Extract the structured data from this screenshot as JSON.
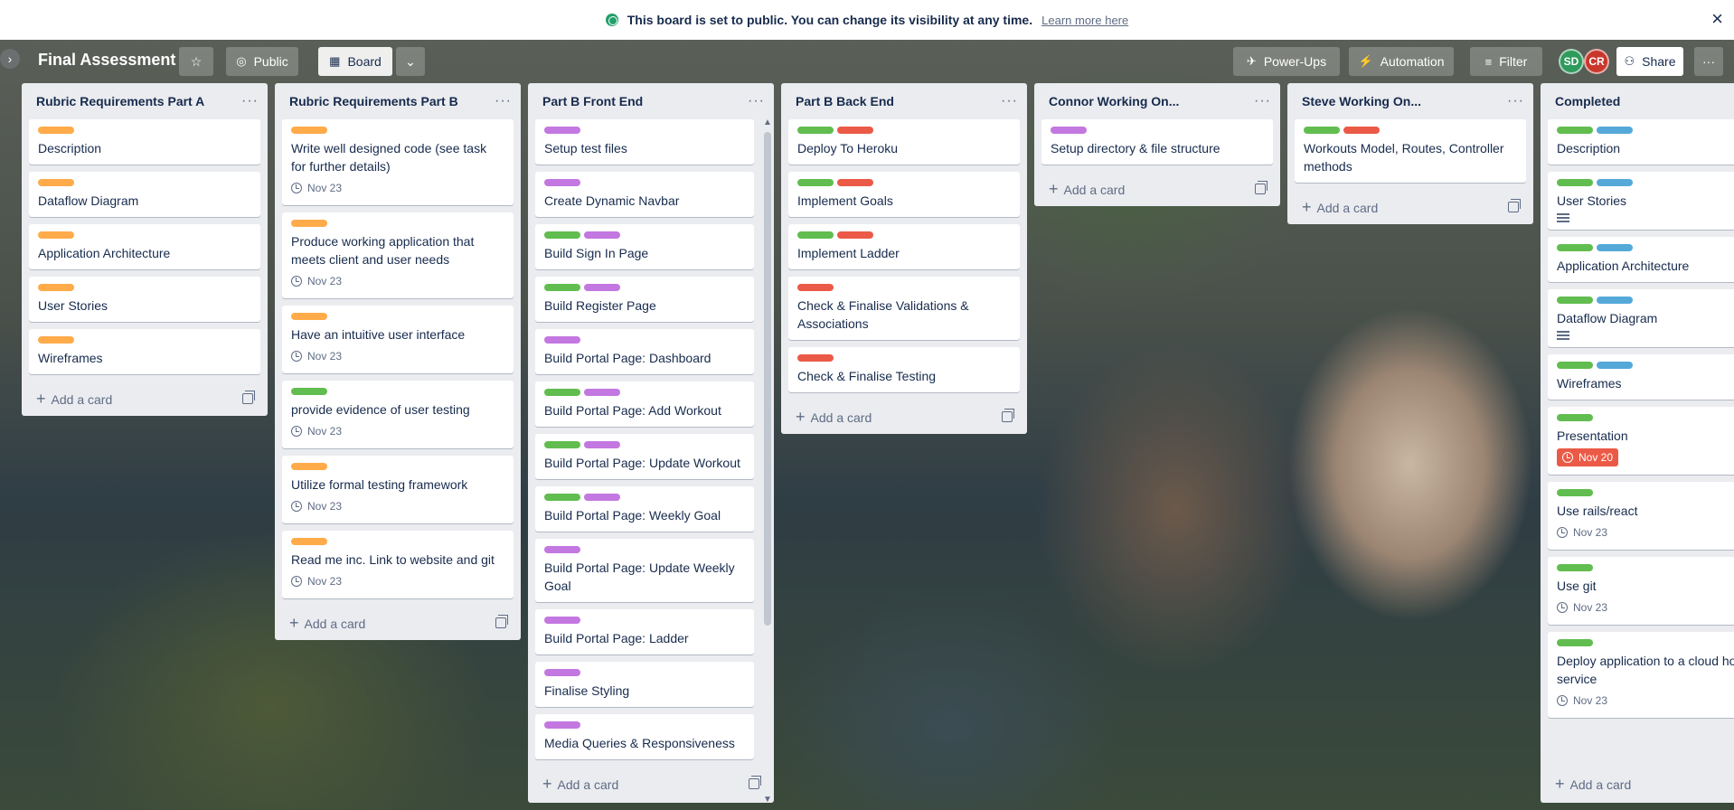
{
  "banner": {
    "message": "This board is set to public. You can change its visibility at any time.",
    "link": "Learn more here",
    "close": "×"
  },
  "colors": {
    "green": "#61bd4f",
    "orange": "#ffab4a",
    "purple": "#c377e0",
    "red": "#eb5a46",
    "blue": "#55a9d9"
  },
  "header": {
    "title": "Final Assessment",
    "visibility": "Public",
    "view": "Board",
    "powerups": "Power-Ups",
    "automation": "Automation",
    "filter": "Filter",
    "share": "Share",
    "avatars": [
      {
        "initials": "SD",
        "color": "#2e9a5b"
      },
      {
        "initials": "CR",
        "color": "#c9372c"
      }
    ],
    "more": "···"
  },
  "common": {
    "add_card": "Add a card"
  },
  "lists": [
    {
      "title": "Rubric Requirements Part A",
      "cards": [
        {
          "labels": [
            "orange"
          ],
          "title": "Description"
        },
        {
          "labels": [
            "orange"
          ],
          "title": "Dataflow Diagram"
        },
        {
          "labels": [
            "orange"
          ],
          "title": "Application Architecture"
        },
        {
          "labels": [
            "orange"
          ],
          "title": "User Stories"
        },
        {
          "labels": [
            "orange"
          ],
          "title": "Wireframes"
        }
      ]
    },
    {
      "title": "Rubric Requirements Part B",
      "cards": [
        {
          "labels": [
            "orange"
          ],
          "title": "Write well designed code (see task for further details)",
          "due": "Nov 23"
        },
        {
          "labels": [
            "orange"
          ],
          "title": "Produce working application that meets client and user needs",
          "due": "Nov 23"
        },
        {
          "labels": [
            "orange"
          ],
          "title": "Have an intuitive user interface",
          "due": "Nov 23"
        },
        {
          "labels": [
            "green"
          ],
          "title": "provide evidence of user testing",
          "due": "Nov 23"
        },
        {
          "labels": [
            "orange"
          ],
          "title": "Utilize formal testing framework",
          "due": "Nov 23"
        },
        {
          "labels": [
            "orange"
          ],
          "title": "Read me inc. Link to website and git",
          "due": "Nov 23"
        }
      ]
    },
    {
      "title": "Part B Front End",
      "cards": [
        {
          "labels": [
            "purple"
          ],
          "title": "Setup test files"
        },
        {
          "labels": [
            "purple"
          ],
          "title": "Create Dynamic Navbar"
        },
        {
          "labels": [
            "green",
            "purple"
          ],
          "title": "Build Sign In Page"
        },
        {
          "labels": [
            "green",
            "purple"
          ],
          "title": "Build Register Page"
        },
        {
          "labels": [
            "purple"
          ],
          "title": "Build Portal Page: Dashboard"
        },
        {
          "labels": [
            "green",
            "purple"
          ],
          "title": "Build Portal Page: Add Workout"
        },
        {
          "labels": [
            "green",
            "purple"
          ],
          "title": "Build Portal Page: Update Workout"
        },
        {
          "labels": [
            "green",
            "purple"
          ],
          "title": "Build Portal Page: Weekly Goal"
        },
        {
          "labels": [
            "purple"
          ],
          "title": "Build Portal Page: Update Weekly Goal"
        },
        {
          "labels": [
            "purple"
          ],
          "title": "Build Portal Page: Ladder"
        },
        {
          "labels": [
            "purple"
          ],
          "title": "Finalise Styling"
        },
        {
          "labels": [
            "purple"
          ],
          "title": "Media Queries & Responsiveness"
        }
      ]
    },
    {
      "title": "Part B Back End",
      "cards": [
        {
          "labels": [
            "green",
            "red"
          ],
          "title": "Deploy To Heroku"
        },
        {
          "labels": [
            "green",
            "red"
          ],
          "title": "Implement Goals"
        },
        {
          "labels": [
            "green",
            "red"
          ],
          "title": "Implement Ladder"
        },
        {
          "labels": [
            "red"
          ],
          "title": "Check & Finalise Validations & Associations"
        },
        {
          "labels": [
            "red"
          ],
          "title": "Check & Finalise Testing"
        }
      ]
    },
    {
      "title": "Connor Working On...",
      "cards": [
        {
          "labels": [
            "purple"
          ],
          "title": "Setup directory & file structure"
        }
      ]
    },
    {
      "title": "Steve Working On...",
      "cards": [
        {
          "labels": [
            "green",
            "red"
          ],
          "title": "Workouts Model, Routes, Controller methods"
        }
      ]
    },
    {
      "title": "Completed",
      "cards": [
        {
          "labels": [
            "green",
            "blue"
          ],
          "title": "Description"
        },
        {
          "labels": [
            "green",
            "blue"
          ],
          "title": "User Stories",
          "description": true
        },
        {
          "labels": [
            "green",
            "blue"
          ],
          "title": "Application Architecture"
        },
        {
          "labels": [
            "green",
            "blue"
          ],
          "title": "Dataflow Diagram",
          "description": true
        },
        {
          "labels": [
            "green",
            "blue"
          ],
          "title": "Wireframes"
        },
        {
          "labels": [
            "green"
          ],
          "title": "Presentation",
          "due": "Nov 20",
          "overdue": true
        },
        {
          "labels": [
            "green"
          ],
          "title": "Use rails/react",
          "due": "Nov 23"
        },
        {
          "labels": [
            "green"
          ],
          "title": "Use git",
          "due": "Nov 23"
        },
        {
          "labels": [
            "green"
          ],
          "title": "Deploy application to a cloud hosting service",
          "due": "Nov 23"
        }
      ]
    }
  ]
}
